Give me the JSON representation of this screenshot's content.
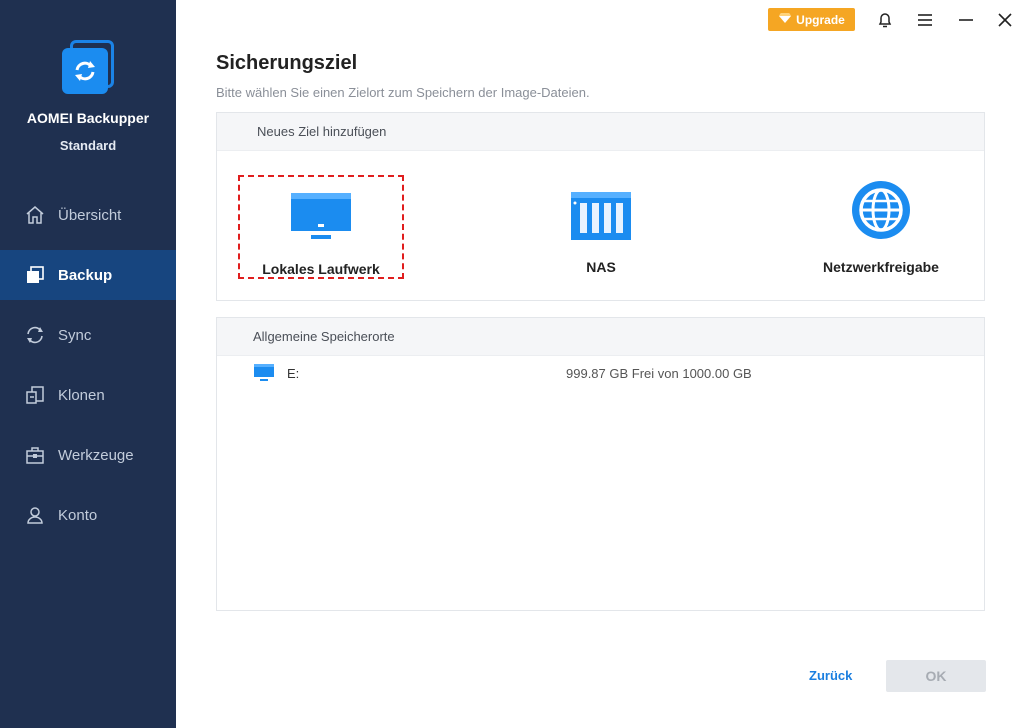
{
  "sidebar": {
    "app_name": "AOMEI Backupper",
    "edition": "Standard",
    "items": [
      {
        "label": "Übersicht",
        "icon": "home-icon"
      },
      {
        "label": "Backup",
        "icon": "backup-icon",
        "active": true
      },
      {
        "label": "Sync",
        "icon": "sync-icon"
      },
      {
        "label": "Klonen",
        "icon": "clone-icon"
      },
      {
        "label": "Werkzeuge",
        "icon": "toolbox-icon"
      },
      {
        "label": "Konto",
        "icon": "user-icon"
      }
    ]
  },
  "topbar": {
    "upgrade_label": "Upgrade"
  },
  "page": {
    "title": "Sicherungsziel",
    "subtitle": "Bitte wählen Sie einen Zielort zum Speichern der Image-Dateien."
  },
  "new_target": {
    "header": "Neues Ziel hinzufügen",
    "options": [
      {
        "label": "Lokales Laufwerk",
        "icon": "monitor-icon",
        "selected": true
      },
      {
        "label": "NAS",
        "icon": "nas-icon"
      },
      {
        "label": "Netzwerkfreigabe",
        "icon": "globe-icon"
      }
    ]
  },
  "locations": {
    "header": "Allgemeine Speicherorte",
    "rows": [
      {
        "name": "E:",
        "free": "999.87 GB Frei von 1000.00 GB"
      }
    ]
  },
  "footer": {
    "back_label": "Zurück",
    "ok_label": "OK"
  },
  "colors": {
    "sidebar_bg": "#1f3050",
    "active_nav": "#17457f",
    "accent_blue": "#1b8cf0",
    "upgrade_orange": "#f5a623",
    "selection_red": "#e01e1e"
  }
}
